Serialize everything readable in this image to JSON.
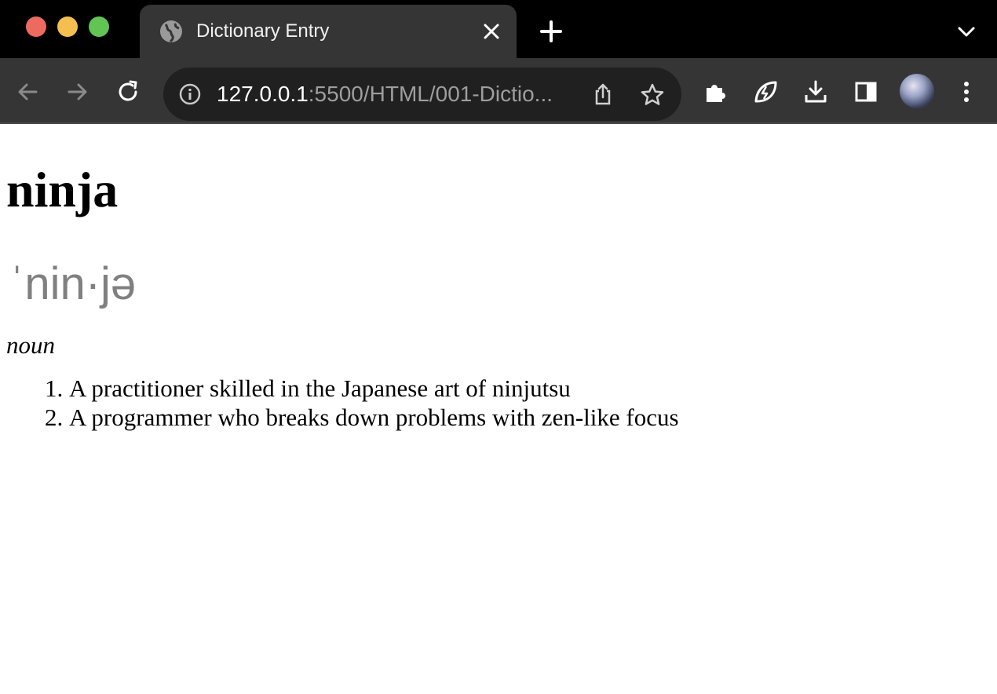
{
  "browser": {
    "tab_title": "Dictionary Entry",
    "url_host": "127.0.0.1",
    "url_path": ":5500/HTML/001-Dictio..."
  },
  "entry": {
    "word": "ninja",
    "pronunciation": "ˈnin·jə",
    "part_of_speech": "noun",
    "definitions": [
      "A practitioner skilled in the Japanese art of ninjutsu",
      "A programmer who breaks down problems with zen-like focus"
    ]
  },
  "colors": {
    "chrome_dark": "#000000",
    "toolbar": "#353535",
    "omnibox": "#202020",
    "pronunciation_gray": "#808080"
  },
  "icons": [
    "globe-icon",
    "close-icon",
    "plus-icon",
    "chevron-down-icon",
    "back-icon",
    "forward-icon",
    "reload-icon",
    "info-icon",
    "share-icon",
    "star-icon",
    "extensions-icon",
    "leaf-icon",
    "download-icon",
    "sidebar-icon",
    "avatar",
    "more-icon"
  ]
}
